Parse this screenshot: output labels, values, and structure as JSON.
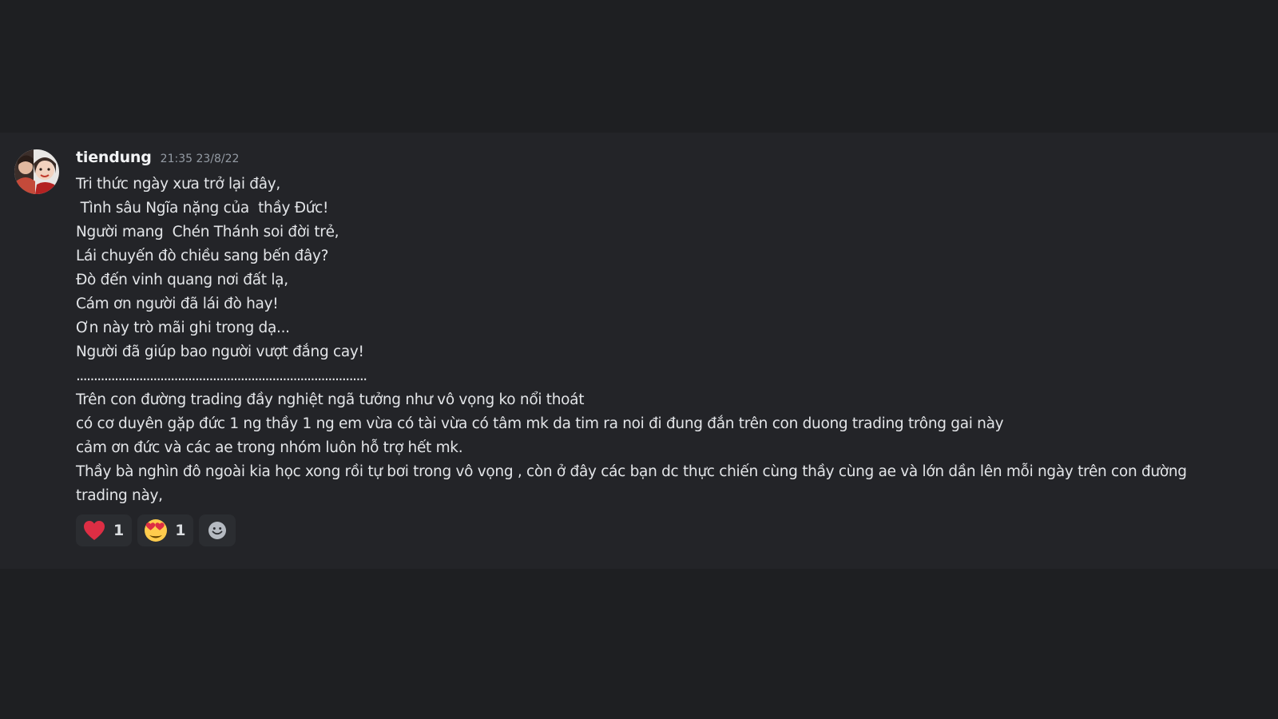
{
  "message": {
    "username": "tiendung",
    "timestamp": "21:35 23/8/22",
    "avatar_icon": "avatar-photo",
    "lines": [
      "Tri thức ngày xưa trở lại đây,",
      " Tình sâu Ngĩa nặng của  thầy Đức!",
      "Người mang  Chén Thánh soi đời trẻ,",
      "Lái chuyến đò chiều sang bến đây?",
      "Đò đến vinh quang nơi đất lạ,",
      "Cám ơn người đã lái đò hay!",
      "Ơn này trò mãi ghi trong dạ...",
      "Người đã giúp bao người vượt đắng cay!",
      "...................................................................................",
      "Trên con đường trading đầy nghiệt ngã tưởng như vô vọng ko nổi thoát",
      "có cơ duyên gặp đức 1 ng thầy 1 ng em vừa có tài vừa có tâm mk da tim ra noi đi đung đắn trên con duong trading trông gai này",
      "cảm ơn đức và các ae trong nhóm luôn hỗ trợ hết mk.",
      "Thầy bà nghìn đô ngoài kia học xong rồi tự bơi trong vô vọng , còn ở đây các bạn dc thực chiến cùng thầy cùng ae và lớn dần lên mỗi ngày trên con đường trading này,"
    ],
    "reactions": [
      {
        "emoji": "heart-icon",
        "count": "1"
      },
      {
        "emoji": "heart-eyes-icon",
        "count": "1"
      }
    ],
    "add_reaction_icon": "add-reaction-icon"
  },
  "colors": {
    "background": "#1e1f22",
    "message_highlight": "#232428",
    "reaction_bg": "#2b2d31",
    "username": "#f2f3f5",
    "timestamp": "#949ba4",
    "heart": "#dd2e44",
    "emoji_face": "#ffcc4d"
  }
}
